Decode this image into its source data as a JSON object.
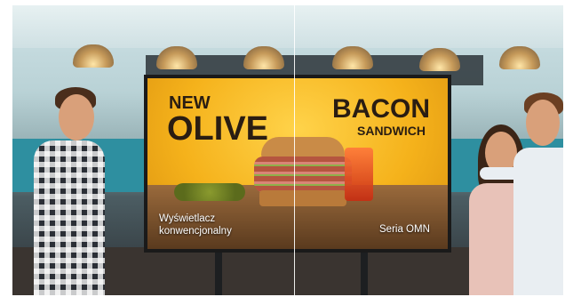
{
  "screen_ad": {
    "left_headline_top": "NEW",
    "left_headline_main": "OLIVE",
    "right_headline_main": "BACON",
    "right_headline_sub": "SANDWICH"
  },
  "comparison": {
    "left_label": "Wyświetlacz\nkonwencjonalny",
    "right_label": "Seria OMN"
  }
}
